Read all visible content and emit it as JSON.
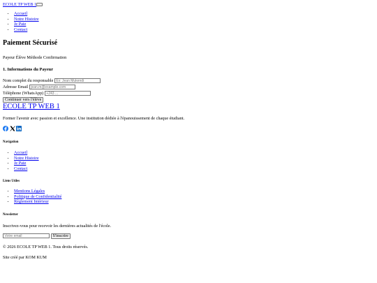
{
  "header": {
    "brand": "ECOLE TP WEB 1",
    "menu_toggle_icon": "hamburger-icon",
    "nav": [
      "Accueil",
      "Notre Histoire",
      "Je Paie",
      "Contact"
    ]
  },
  "main": {
    "title": "Paiement Sécurisé",
    "steps": [
      "Payeur",
      "Élève",
      "Méthode",
      "Confirmation"
    ],
    "section_title": "1. Informations du Payeur",
    "fields": [
      {
        "label": "Nom complet du responsable",
        "placeholder": "Ex: Jean Mukendi"
      },
      {
        "label": "Adresse Email",
        "placeholder": "jean.m@example.com"
      },
      {
        "label": "Téléphone (WhatsApp)",
        "placeholder": "+243 ..."
      }
    ],
    "continue_label": "Continuer vers l'élève"
  },
  "footer": {
    "brand": "ECOLE TP WEB 1",
    "tagline": "Former l'avenir avec passion et excellence. Une institution dédiée à l'épanouissement de chaque étudiant.",
    "socials": [
      {
        "icon": "facebook-icon",
        "color": "#1877f2"
      },
      {
        "icon": "x-icon",
        "color": "#000000"
      },
      {
        "icon": "linkedin-icon",
        "color": "#0a66c2"
      }
    ],
    "nav_heading": "Navigation",
    "nav": [
      "Accueil",
      "Notre Histoire",
      "Je Paie",
      "Contact"
    ],
    "links_heading": "Liens Utiles",
    "links": [
      "Mentions Légales",
      "Politique de Confidentialité",
      "Règlement Intérieur"
    ],
    "newsletter_heading": "Newsletter",
    "newsletter_text": "Inscrivez-vous pour recevoir les dernières actualités de l'école.",
    "newsletter_placeholder": "Votre email",
    "subscribe_label": "S'inscrire",
    "copyright": "© 2026 ECOLE TP WEB 1. Tous droits réservés.",
    "credit": "Site créé par KOM KUM"
  }
}
